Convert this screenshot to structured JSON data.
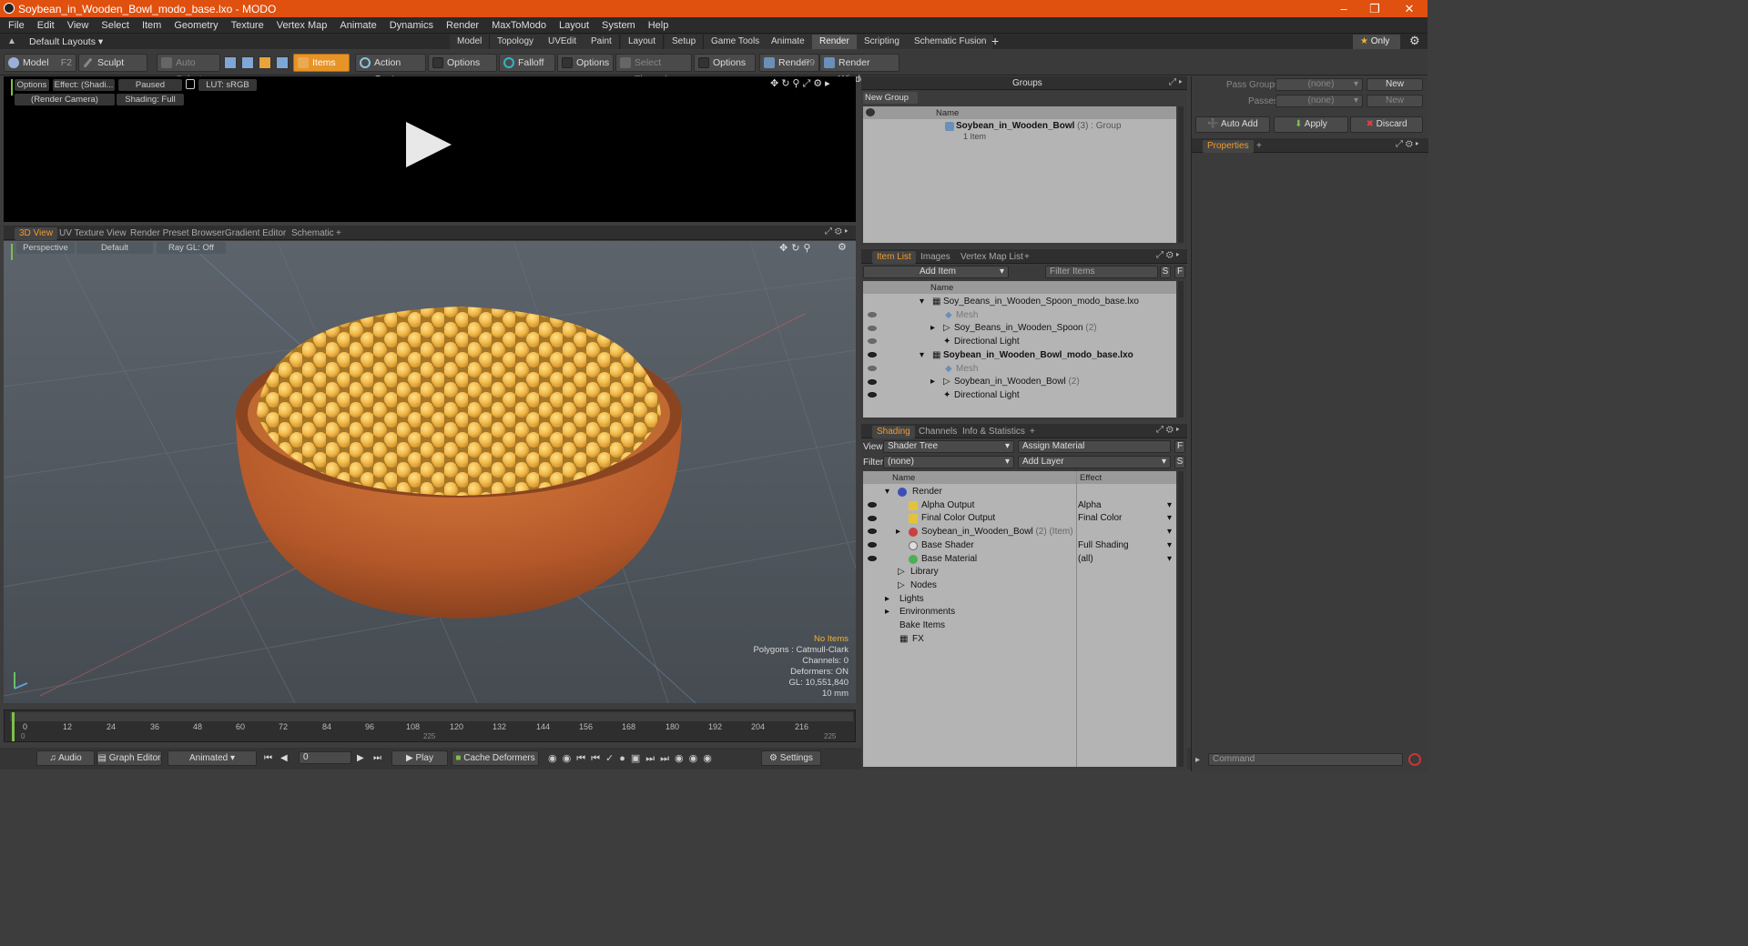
{
  "window": {
    "title": "Soybean_in_Wooden_Bowl_modo_base.lxo - MODO"
  },
  "menu": [
    "File",
    "Edit",
    "View",
    "Select",
    "Item",
    "Geometry",
    "Texture",
    "Vertex Map",
    "Animate",
    "Dynamics",
    "Render",
    "MaxToModo",
    "Layout",
    "System",
    "Help"
  ],
  "layout": {
    "preset": "Default Layouts",
    "tabs": [
      "Model",
      "Topology",
      "UVEdit",
      "Paint",
      "Layout",
      "Setup",
      "Game Tools",
      "Animate",
      "Render",
      "Scripting",
      "Schematic Fusion"
    ],
    "active_tab": "Render",
    "only_label": "Only"
  },
  "toolbar": {
    "model": "Model",
    "model_key": "F2",
    "sculpt": "Sculpt",
    "auto_select": "Auto Select",
    "items": "Items",
    "action_center": "Action Center",
    "options1": "Options",
    "falloff": "Falloff",
    "options2": "Options",
    "select_through": "Select Through",
    "options3": "Options",
    "render": "Render",
    "render_key": "F9",
    "render_window": "Render Window"
  },
  "render_view": {
    "options": "Options",
    "effect": "Effect: (Shadi...",
    "paused": "Paused",
    "lut": "LUT: sRGB",
    "camera": "(Render Camera)",
    "shading": "Shading: Full"
  },
  "viewport": {
    "tabs": [
      "3D View",
      "UV Texture View",
      "Render Preset Browser",
      "Gradient Editor",
      "Schematic"
    ],
    "perspective": "Perspective",
    "default": "Default",
    "raygl": "Ray GL: Off",
    "stats": [
      "No Items",
      "Polygons : Catmull-Clark",
      "Channels: 0",
      "Deformers: ON",
      "GL: 10,551,840",
      "10 mm"
    ]
  },
  "groups": {
    "title": "Groups",
    "new_group": "New Group",
    "col_name": "Name",
    "item_name": "Soybean_in_Wooden_Bowl",
    "item_suffix": "(3) : Group",
    "item_sub": "1 Item"
  },
  "item_list": {
    "tabs": [
      "Item List",
      "Images",
      "Vertex Map List"
    ],
    "add_item": "Add Item",
    "filter": "Filter Items",
    "col_name": "Name",
    "rows": [
      {
        "name": "Soy_Beans_in_Wooden_Spoon_modo_base.lxo",
        "indent": 0
      },
      {
        "name": "Mesh",
        "indent": 2,
        "dim": true
      },
      {
        "name": "Soy_Beans_in_Wooden_Spoon",
        "suffix": "(2)",
        "indent": 1
      },
      {
        "name": "Directional Light",
        "indent": 1
      },
      {
        "name": "Soybean_in_Wooden_Bowl_modo_base.lxo",
        "indent": 0,
        "bold": true
      },
      {
        "name": "Mesh",
        "indent": 2,
        "dim": true
      },
      {
        "name": "Soybean_in_Wooden_Bowl",
        "suffix": "(2)",
        "indent": 1
      },
      {
        "name": "Directional Light",
        "indent": 1
      }
    ]
  },
  "shading": {
    "tabs": [
      "Shading",
      "Channels",
      "Info & Statistics"
    ],
    "view_label": "View",
    "view_value": "Shader Tree",
    "assign": "Assign Material",
    "filter_label": "Filter",
    "filter_value": "(none)",
    "add_layer": "Add Layer",
    "col_name": "Name",
    "col_effect": "Effect",
    "rows": [
      {
        "name": "Render",
        "effect": "",
        "indent": 0
      },
      {
        "name": "Alpha Output",
        "effect": "Alpha",
        "indent": 1
      },
      {
        "name": "Final Color Output",
        "effect": "Final Color",
        "indent": 1
      },
      {
        "name": "Soybean_in_Wooden_Bowl",
        "suffix": "(2) (Item)",
        "effect": "",
        "indent": 1
      },
      {
        "name": "Base Shader",
        "effect": "Full Shading",
        "indent": 1
      },
      {
        "name": "Base Material",
        "effect": "(all)",
        "indent": 1
      },
      {
        "name": "Library",
        "effect": "",
        "indent": 0
      },
      {
        "name": "Nodes",
        "effect": "",
        "indent": 0
      },
      {
        "name": "Lights",
        "effect": "",
        "indent": 0
      },
      {
        "name": "Environments",
        "effect": "",
        "indent": 0
      },
      {
        "name": "Bake Items",
        "effect": "",
        "indent": 0
      },
      {
        "name": "FX",
        "effect": "",
        "indent": 0
      }
    ]
  },
  "passes": {
    "pass_groups": "Pass Groups",
    "passes": "Passes",
    "none": "(none)",
    "new": "New",
    "auto_add": "Auto Add",
    "apply": "Apply",
    "discard": "Discard",
    "properties": "Properties"
  },
  "timeline": {
    "ticks": [
      "0",
      "12",
      "24",
      "36",
      "48",
      "60",
      "72",
      "84",
      "96",
      "108",
      "120",
      "132",
      "144",
      "156",
      "168",
      "180",
      "192",
      "204",
      "216"
    ],
    "sub_left": "0",
    "sub_mid": "225",
    "sub_right": "225"
  },
  "bottom": {
    "audio": "Audio",
    "graph_editor": "Graph Editor",
    "animated": "Animated",
    "frame": "0",
    "play": "Play",
    "cache_deformers": "Cache Deformers",
    "settings": "Settings",
    "command": "Command"
  }
}
